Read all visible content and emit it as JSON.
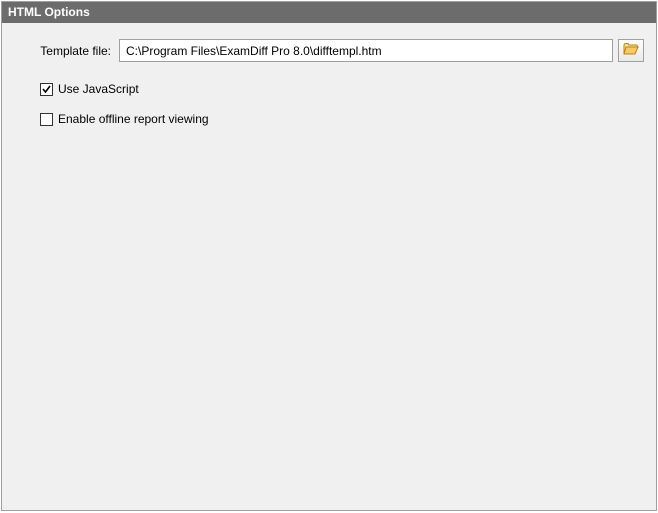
{
  "title": "HTML Options",
  "template": {
    "label": "Template file:",
    "value": "C:\\Program Files\\ExamDiff Pro 8.0\\difftempl.htm"
  },
  "checkboxes": {
    "use_js": {
      "label": "Use JavaScript",
      "checked": true
    },
    "offline": {
      "label": "Enable offline report viewing",
      "checked": false
    }
  }
}
